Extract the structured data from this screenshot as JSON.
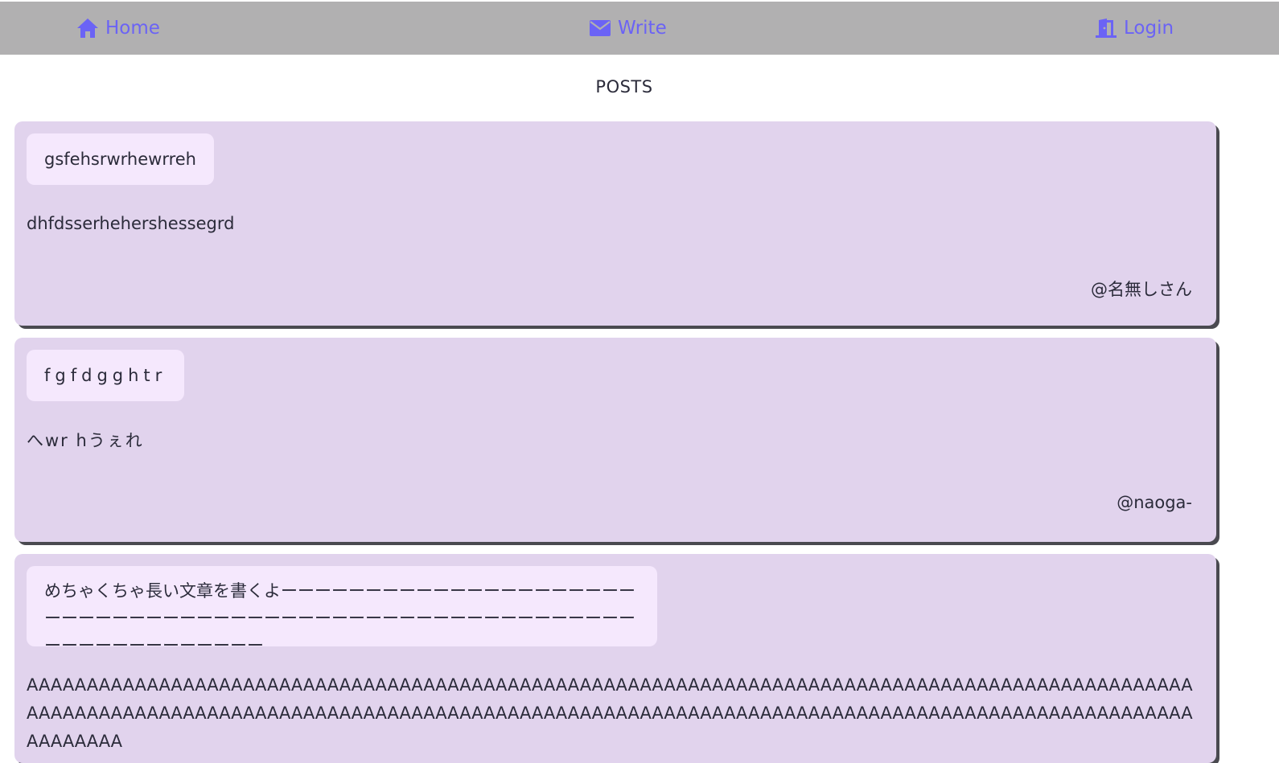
{
  "nav": {
    "home_label": "Home",
    "write_label": "Write",
    "login_label": "Login",
    "link_color": "#6b63f5",
    "background": "#b1b0b1",
    "home_icon": "home-icon",
    "write_icon": "envelope-icon",
    "login_icon": "door-open-icon"
  },
  "page": {
    "title": "POSTS"
  },
  "posts": [
    {
      "title": "gsfehsrwrhewrreh",
      "body": "dhfdsserhehershessegrd",
      "author": "@名無しさん"
    },
    {
      "title": "fgfdgghtr",
      "body": "へwr hうぇれ",
      "author": "@naoga-"
    },
    {
      "title": "めちゃくちゃ長い文章を書くよーーーーーーーーーーーーーーーーーーーーーーーーーーーーーーーーーーーーーーーーーーーーーーーーーーーーーーーーーーーーーーーーーーーーー",
      "body": "AAAAAAAAAAAAAAAAAAAAAAAAAAAAAAAAAAAAAAAAAAAAAAAAAAAAAAAAAAAAAAAAAAAAAAAAAAAAAAAAAAAAAAAAAAAAAAAAAAAAAAAAAAAAAAAAAAAAAAAAAAAAAAAAAAAAAAAAAAAAAAAAAAAAAAAAAAAAAAAAAAAAAAAAAAAAAAAAAAAAAAAAAAAAAAAAAAAAAAAAAA",
      "author": ""
    }
  ],
  "colors": {
    "card_background": "#e1d3ed",
    "title_background": "#f5e8fd",
    "card_shadow": "#4a4a50"
  }
}
